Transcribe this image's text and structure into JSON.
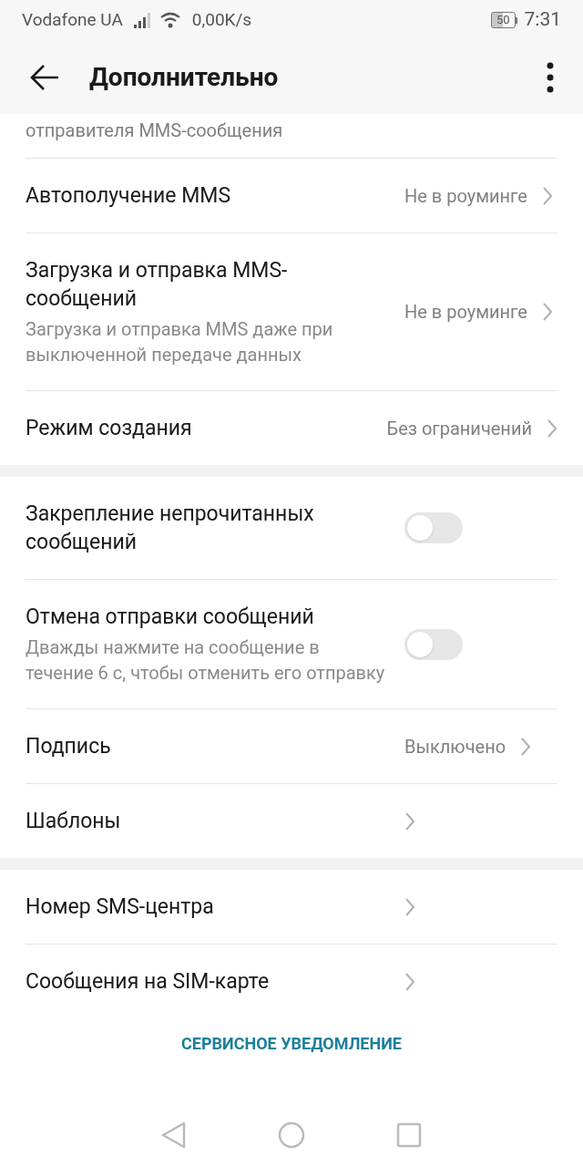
{
  "status_bar": {
    "carrier": "Vodafone UA",
    "speed": "0,00K/s",
    "battery": "50",
    "time": "7:31"
  },
  "header": {
    "title": "Дополнительно"
  },
  "sections": [
    {
      "rows": [
        {
          "kind": "partial",
          "subtitle": "отправителя MMS-сообщения"
        },
        {
          "kind": "link",
          "title": "Автополучение MMS",
          "value": "Не в роуминге"
        },
        {
          "kind": "link",
          "title": "Загрузка и отправка MMS-сообщений",
          "subtitle": "Загрузка и отправка MMS даже при выключенной передаче данных",
          "value": "Не в роуминге"
        },
        {
          "kind": "link",
          "title": "Режим создания",
          "value": "Без ограничений"
        }
      ]
    },
    {
      "rows": [
        {
          "kind": "toggle",
          "title": "Закрепление непрочитанных сообщений",
          "on": false
        },
        {
          "kind": "toggle",
          "title": "Отмена отправки сообщений",
          "subtitle": "Дважды нажмите на сообщение в течение 6 с, чтобы отменить его отправку",
          "on": false
        },
        {
          "kind": "link",
          "title": "Подпись",
          "value": "Выключено"
        },
        {
          "kind": "link",
          "title": "Шаблоны"
        }
      ]
    },
    {
      "rows": [
        {
          "kind": "link",
          "title": "Номер SMS-центра"
        },
        {
          "kind": "link",
          "title": "Сообщения на SIM-карте"
        }
      ]
    }
  ],
  "footer_link": "СЕРВИСНОЕ УВЕДОМЛЕНИЕ"
}
